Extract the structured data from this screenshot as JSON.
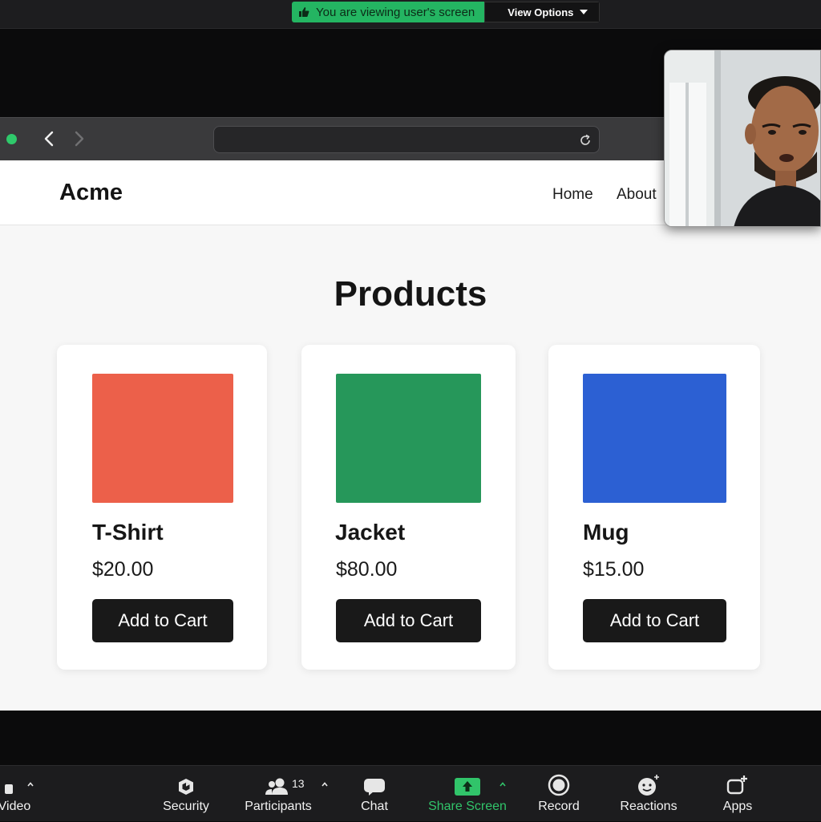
{
  "banner": {
    "share_message": "You are viewing user's screen",
    "view_options_label": "View Options"
  },
  "site": {
    "logo": "Acme",
    "nav": [
      "Home",
      "About"
    ],
    "page_title": "Products",
    "products": [
      {
        "name": "T-Shirt",
        "price": "$20.00",
        "button": "Add to Cart",
        "color": "#ec604a"
      },
      {
        "name": "Jacket",
        "price": "$80.00",
        "button": "Add to Cart",
        "color": "#26975a"
      },
      {
        "name": "Mug",
        "price": "$15.00",
        "button": "Add to Cart",
        "color": "#2c60d3"
      }
    ]
  },
  "toolbar": {
    "video_label": "Video",
    "security_label": "Security",
    "participants_label": "Participants",
    "participants_count": "13",
    "chat_label": "Chat",
    "share_label": "Share Screen",
    "record_label": "Record",
    "reactions_label": "Reactions",
    "apps_label": "Apps"
  },
  "colors": {
    "share_green": "#24b562",
    "toolbar_bg": "#1c1c1e",
    "button_dark": "#191919"
  }
}
